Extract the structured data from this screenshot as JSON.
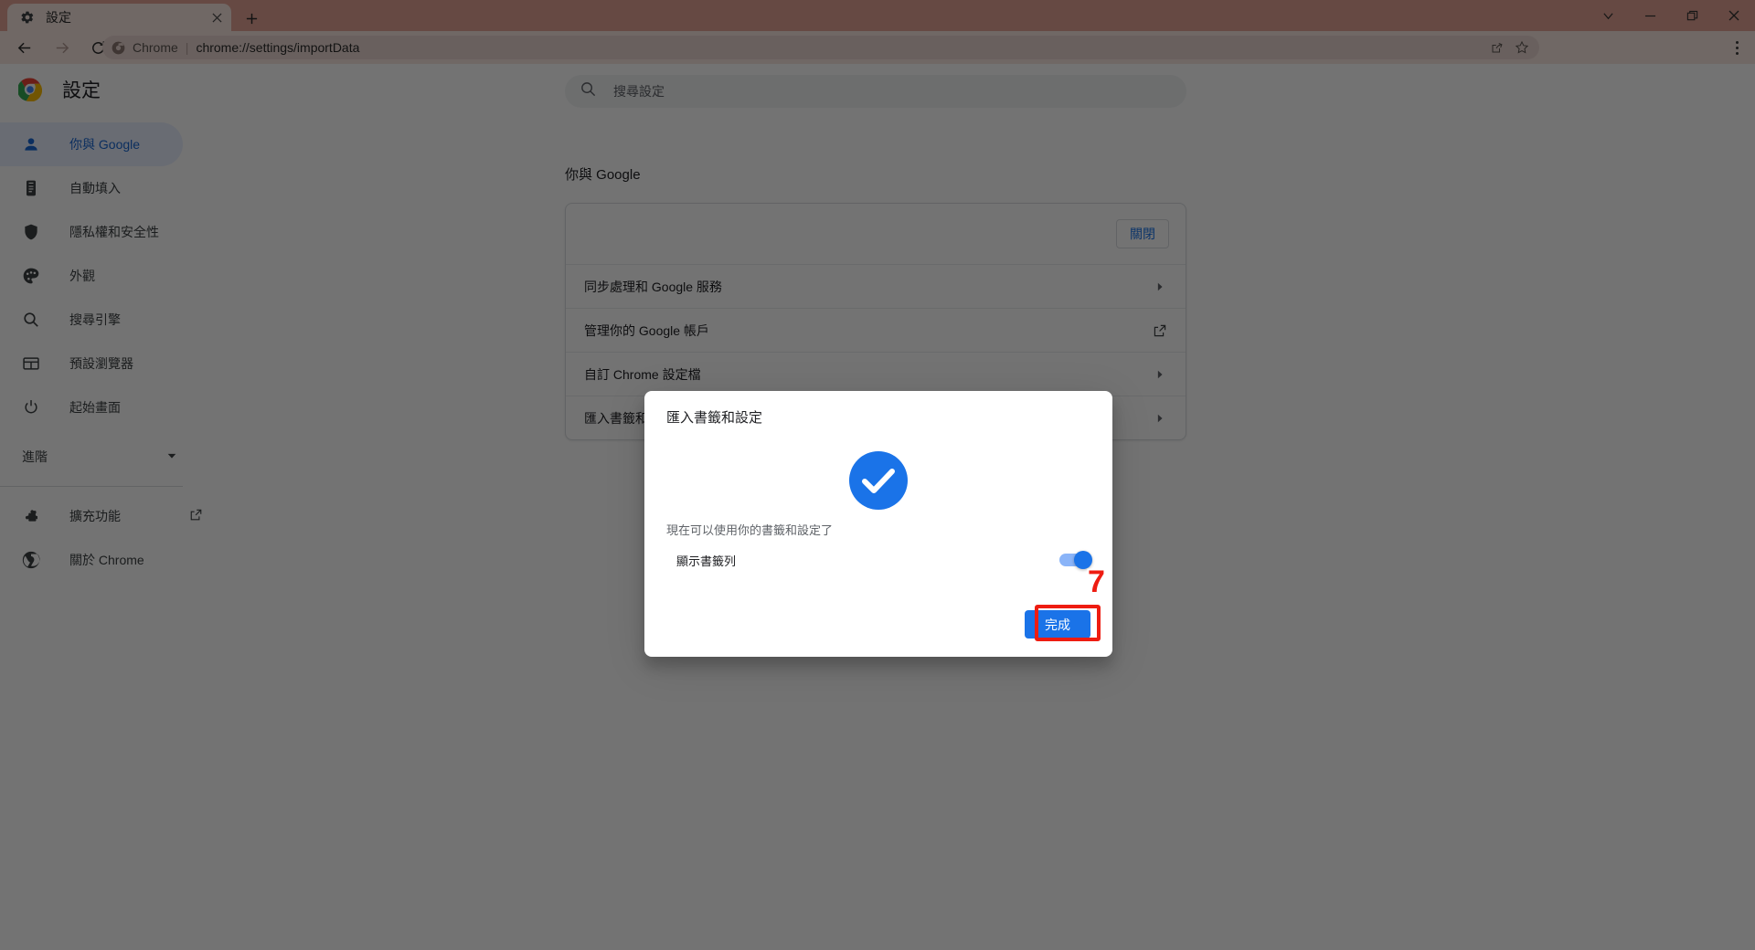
{
  "window": {
    "tab": {
      "title": "設定",
      "favicon_icon": "gear-icon",
      "close_icon": "close-icon"
    },
    "newtab_icon": "plus-icon",
    "controls": [
      {
        "name": "tab-search-button",
        "icon": "chevron-down-icon"
      },
      {
        "name": "minimize-button",
        "icon": "minimize-icon"
      },
      {
        "name": "maximize-button",
        "icon": "maximize-icon"
      },
      {
        "name": "close-window-button",
        "icon": "close-icon"
      }
    ]
  },
  "toolbar": {
    "back_icon": "arrow-left-icon",
    "forward_icon": "arrow-right-icon",
    "reload_icon": "reload-icon",
    "omnibox": {
      "site_icon": "chrome-icon",
      "scheme_label": "Chrome",
      "separator": "|",
      "url": "chrome://settings/importData",
      "share_icon": "share-icon",
      "bookmark_icon": "star-icon"
    },
    "menu_icon": "three-dots-vertical-icon"
  },
  "settings": {
    "logo_icon": "chrome-logo-icon",
    "title": "設定",
    "search": {
      "icon": "search-icon",
      "placeholder": "搜尋設定",
      "value": ""
    },
    "sidebar": {
      "items": [
        {
          "label": "你與 Google",
          "icon": "person-icon",
          "active": true
        },
        {
          "label": "自動填入",
          "icon": "clipboard-icon",
          "active": false
        },
        {
          "label": "隱私權和安全性",
          "icon": "shield-icon",
          "active": false
        },
        {
          "label": "外觀",
          "icon": "palette-icon",
          "active": false
        },
        {
          "label": "搜尋引擎",
          "icon": "search-icon",
          "active": false
        },
        {
          "label": "預設瀏覽器",
          "icon": "browser-window-icon",
          "active": false
        },
        {
          "label": "起始畫面",
          "icon": "power-icon",
          "active": false
        }
      ],
      "advanced": {
        "label": "進階",
        "icon": "chevron-down-icon"
      },
      "footer_items": [
        {
          "label": "擴充功能",
          "icon": "puzzle-icon",
          "end_icon": "external-link-icon"
        },
        {
          "label": "關於 Chrome",
          "icon": "chrome-icon",
          "end_icon": ""
        }
      ]
    },
    "main": {
      "section_title": "你與 Google",
      "turn_off_label": "關閉",
      "rows": [
        {
          "label": "同步處理和 Google 服務",
          "end_icon": "chevron-right-icon"
        },
        {
          "label": "管理你的 Google 帳戶",
          "end_icon": "external-link-icon"
        },
        {
          "label": "自訂 Chrome 設定檔",
          "end_icon": "chevron-right-icon"
        },
        {
          "label": "匯入書籤和設定",
          "end_icon": "chevron-right-icon"
        }
      ]
    }
  },
  "dialog": {
    "title": "匯入書籤和設定",
    "success_icon": "check-circle-icon",
    "message": "現在可以使用你的書籤和設定了",
    "toggle": {
      "label": "顯示書籤列",
      "state": "on"
    },
    "done_label": "完成"
  },
  "annotation": {
    "step_number": "7",
    "color": "#ee1c11"
  },
  "colors": {
    "accent_blue": "#1a73e8",
    "titlebar": "#e3a394",
    "toolbar": "#f8e6e0",
    "omnibox": "#e9d6d0",
    "active_nav_bg": "#e8f0fe",
    "active_nav_text": "#1967d2",
    "scrim": "rgba(0,0,0,0.55)"
  }
}
